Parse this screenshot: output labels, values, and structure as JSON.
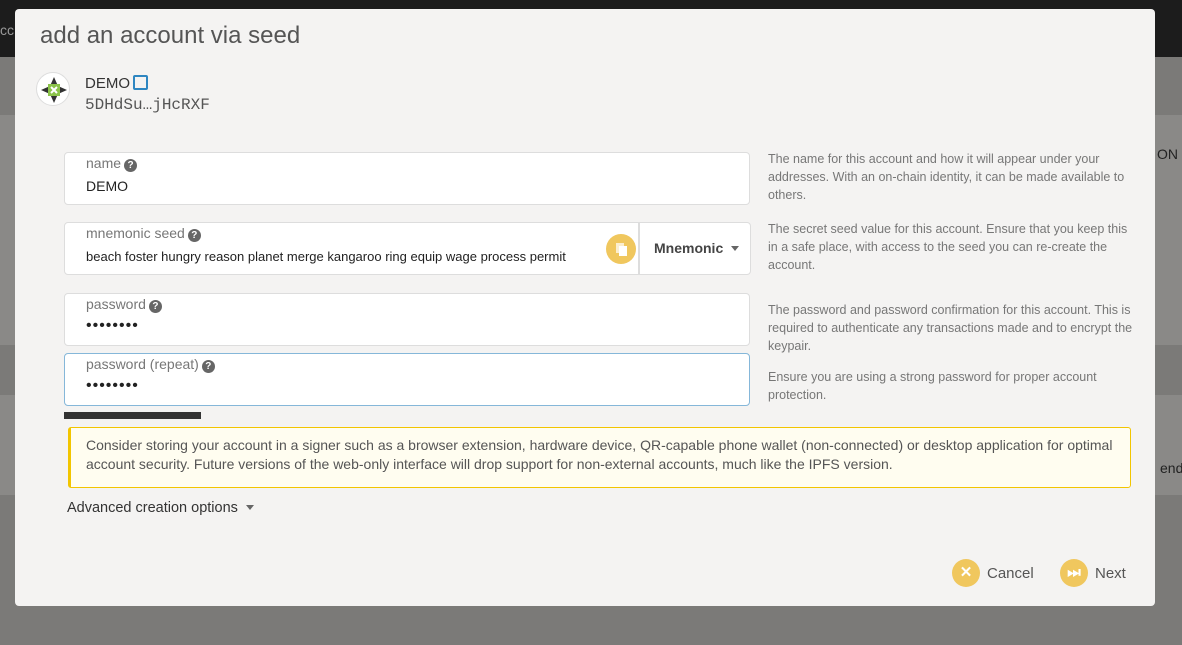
{
  "background": {
    "left_text": "cc",
    "right_text_1": "ON",
    "right_text_2": "end"
  },
  "modal": {
    "title": "add an account via seed",
    "account": {
      "name": "DEMO",
      "address": "5DHdSu…jHcRXF"
    },
    "fields": {
      "name": {
        "label": "name",
        "value": "DEMO",
        "help": "The name for this account and how it will appear under your addresses. With an on-chain identity, it can be made available to others."
      },
      "seed": {
        "label": "mnemonic seed",
        "value": "beach foster hungry reason planet merge kangaroo ring equip wage process permit",
        "type": "Mnemonic",
        "help": "The secret seed value for this account. Ensure that you keep this in a safe place, with access to the seed you can re-create the account."
      },
      "password": {
        "label": "password",
        "value": "••••••••",
        "help": "The password and password confirmation for this account. This is required to authenticate any transactions made and to encrypt the keypair."
      },
      "password_repeat": {
        "label": "password (repeat)",
        "value": "••••••••",
        "help": "Ensure you are using a strong password for proper account protection."
      }
    },
    "warning": "Consider storing your account in a signer such as a browser extension, hardware device, QR-capable phone wallet (non-connected) or desktop application for optimal account security. Future versions of the web-only interface will drop support for non-external accounts, much like the IPFS version.",
    "advanced": "Advanced creation options",
    "cancel": "Cancel",
    "next": "Next"
  },
  "colors": {
    "accent": "#f0c75e",
    "warning_border": "#f2c500",
    "edit_icon": "#2e86c1"
  }
}
